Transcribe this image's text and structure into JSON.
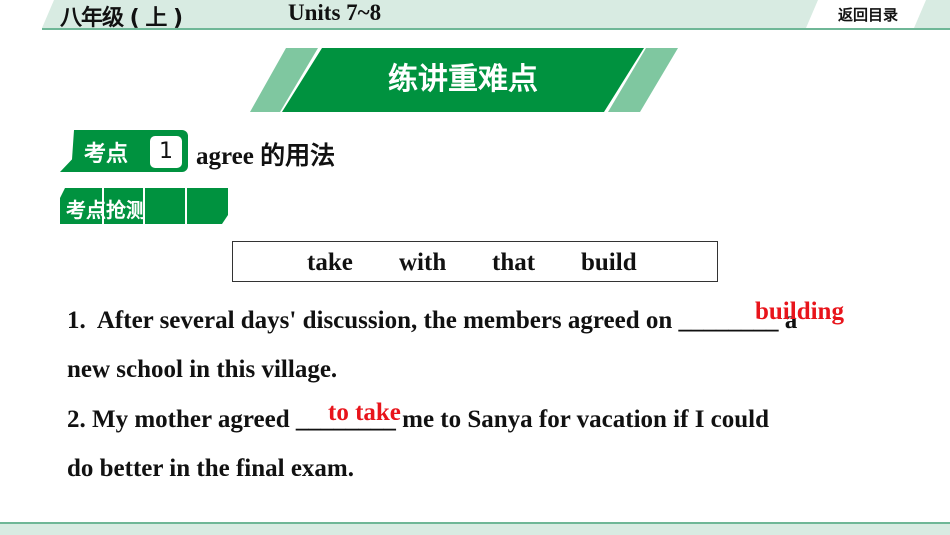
{
  "header": {
    "grade": "八年级 ( 上 )",
    "units": "Units 7~8",
    "back": "返回目录"
  },
  "banner": {
    "title": "练讲重难点"
  },
  "point": {
    "label": "考点",
    "number": "1",
    "title": "agree 的用法"
  },
  "practice": {
    "label": "考点抢测"
  },
  "word_box": [
    "take",
    "with",
    "that",
    "build"
  ],
  "questions": [
    {
      "line1": "1.  After several days' discussion, the members agreed on ________ a",
      "line2": "new school in this village.",
      "answer": "building"
    },
    {
      "line1": "2. My mother agreed ________ me to Sanya for vacation if I could",
      "line2": "do better in the final exam.",
      "answer": "to take"
    }
  ],
  "colors": {
    "green": "#00923f",
    "light_green": "#7fc7a0",
    "answer": "#e8141b"
  }
}
